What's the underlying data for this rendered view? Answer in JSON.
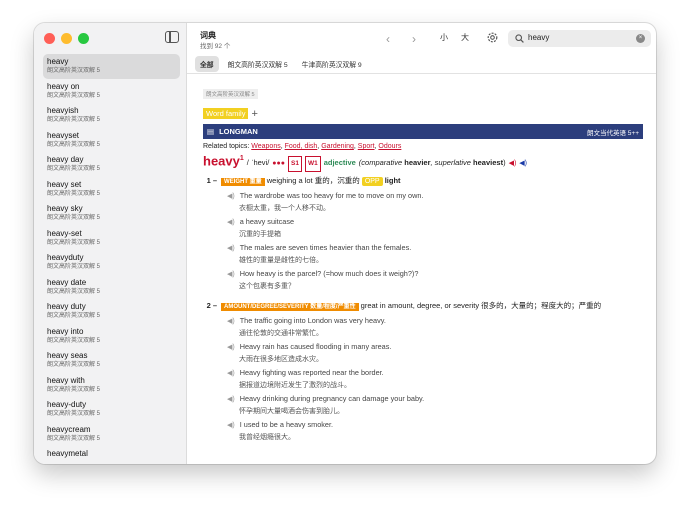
{
  "window": {
    "title": "词典",
    "subtitle": "找到 92 个"
  },
  "toolbar": {
    "back": "‹",
    "forward": "›",
    "small": "小",
    "large": "大",
    "search_value": "heavy",
    "clear": "×"
  },
  "tabs": [
    "全部",
    "朗文高阶英汉双解 5",
    "牛津高阶英汉双解 9"
  ],
  "sidebar": {
    "items": [
      {
        "word": "heavy",
        "src": "朗文高阶英汉双解 5"
      },
      {
        "word": "heavy on",
        "src": "朗文高阶英汉双解 5"
      },
      {
        "word": "heavyish",
        "src": "朗文高阶英汉双解 5"
      },
      {
        "word": "heavyset",
        "src": "朗文高阶英汉双解 5"
      },
      {
        "word": "heavy day",
        "src": "朗文高阶英汉双解 5"
      },
      {
        "word": "heavy set",
        "src": "朗文高阶英汉双解 5"
      },
      {
        "word": "heavy sky",
        "src": "朗文高阶英汉双解 5"
      },
      {
        "word": "heavy-set",
        "src": "朗文高阶英汉双解 5"
      },
      {
        "word": "heavyduty",
        "src": "朗文高阶英汉双解 5"
      },
      {
        "word": "heavy date",
        "src": "朗文高阶英汉双解 5"
      },
      {
        "word": "heavy duty",
        "src": "朗文高阶英汉双解 5"
      },
      {
        "word": "heavy into",
        "src": "朗文高阶英汉双解 5"
      },
      {
        "word": "heavy seas",
        "src": "朗文高阶英汉双解 5"
      },
      {
        "word": "heavy with",
        "src": "朗文高阶英汉双解 5"
      },
      {
        "word": "heavy-duty",
        "src": "朗文高阶英汉双解 5"
      },
      {
        "word": "heavycream",
        "src": "朗文高阶英汉双解 5"
      },
      {
        "word": "heavymetal",
        "src": ""
      }
    ]
  },
  "entry": {
    "source_tag": "朗文高阶英汉双解 5",
    "word_family": "Word family",
    "banner_left": "LONGMAN",
    "banner_right": "朗文当代英语 5++",
    "related_label": "Related topics:",
    "related": [
      "Weapons",
      "Food, dish",
      "Gardening",
      "Sport",
      "Odours"
    ],
    "headword": "heavy",
    "hom": "1",
    "pron": "/ ˈhevi/",
    "dots": "●●●",
    "freq": [
      "S1",
      "W1"
    ],
    "pos": "adjective",
    "forms_pre": "(comparative ",
    "comparative": "heavier",
    "forms_mid": ", superlative ",
    "superlative": "heaviest",
    "forms_post": ")",
    "senses": [
      {
        "num": "1 –",
        "signpost": "WEIGHT 重量",
        "def": "weighing a lot 重的，沉重的",
        "opp_label": "OPP",
        "opp": "light",
        "examples": [
          {
            "en": "The wardrobe was too heavy for me to move on my own.",
            "zh": "衣橱太重，我一个人移不动。"
          },
          {
            "en": "a heavy suitcase",
            "zh": "沉重的手提箱"
          },
          {
            "en": "The males are seven times heavier than the females.",
            "zh": "雄性的重量是雌性的七倍。"
          },
          {
            "en": "How heavy is the parcel? (=how much does it weigh?)?",
            "zh": "这个包裹有多重？"
          }
        ]
      },
      {
        "num": "2 –",
        "signpost": "AMOUNT/DEGREE/SEVERITY 数量/程度/严重性",
        "def": "great in amount, degree, or severity 很多的，大量的；程度大的；严重的",
        "examples": [
          {
            "en": "The traffic going into London was very heavy.",
            "zh": "通往伦敦的交通非常繁忙。"
          },
          {
            "en": "Heavy rain has caused flooding in many areas.",
            "zh": "大雨在很多地区造成水灾。"
          },
          {
            "en": "Heavy fighting was reported near the border.",
            "zh": "据报道边境附近发生了激烈的战斗。"
          },
          {
            "en": "Heavy drinking during pregnancy can damage your baby.",
            "zh": "怀孕期间大量喝酒会伤害到胎儿。"
          },
          {
            "en": "I used to be a heavy smoker.",
            "zh": "我曾经烟瘾很大。"
          }
        ]
      }
    ]
  },
  "colors": {
    "accent": "#c8102e",
    "banner": "#2c3e7d",
    "signpost": "#f08c00",
    "word_family": "#f2d021",
    "pos": "#2e8b57"
  }
}
